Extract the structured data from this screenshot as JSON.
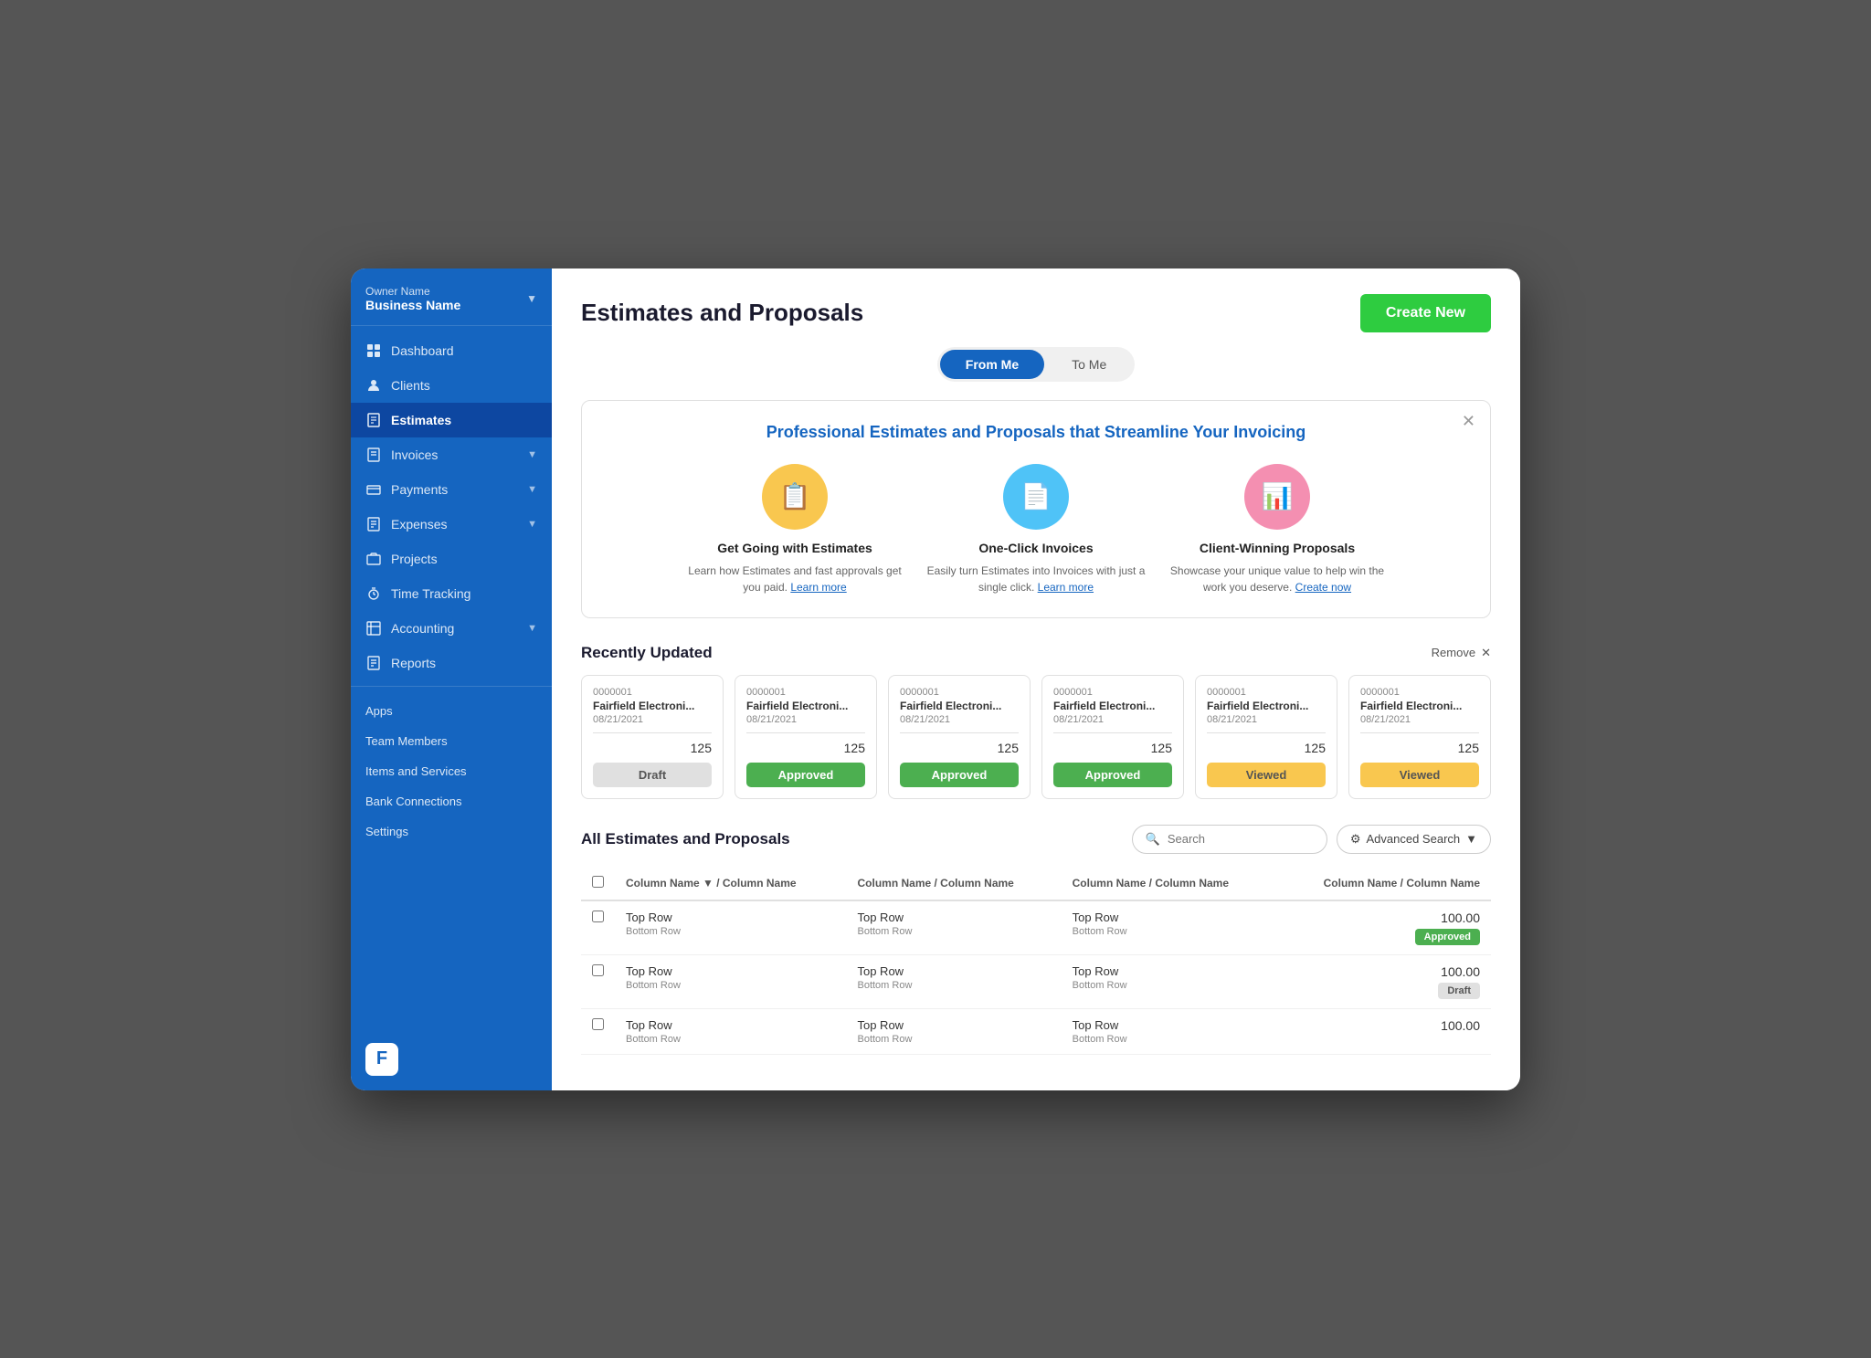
{
  "sidebar": {
    "owner": "Owner Name",
    "business": "Business Name",
    "nav": [
      {
        "id": "dashboard",
        "label": "Dashboard",
        "icon": "📊",
        "active": false,
        "hasChevron": false
      },
      {
        "id": "clients",
        "label": "Clients",
        "icon": "👤",
        "active": false,
        "hasChevron": false
      },
      {
        "id": "estimates",
        "label": "Estimates",
        "icon": "📋",
        "active": true,
        "hasChevron": false
      },
      {
        "id": "invoices",
        "label": "Invoices",
        "icon": "🧾",
        "active": false,
        "hasChevron": true
      },
      {
        "id": "payments",
        "label": "Payments",
        "icon": "💳",
        "active": false,
        "hasChevron": true
      },
      {
        "id": "expenses",
        "label": "Expenses",
        "icon": "📁",
        "active": false,
        "hasChevron": true
      },
      {
        "id": "projects",
        "label": "Projects",
        "icon": "🗂️",
        "active": false,
        "hasChevron": false
      },
      {
        "id": "time-tracking",
        "label": "Time Tracking",
        "icon": "⏱",
        "active": false,
        "hasChevron": false
      },
      {
        "id": "accounting",
        "label": "Accounting",
        "icon": "📈",
        "active": false,
        "hasChevron": true
      },
      {
        "id": "reports",
        "label": "Reports",
        "icon": "📊",
        "active": false,
        "hasChevron": false
      }
    ],
    "secondary": [
      {
        "id": "apps",
        "label": "Apps"
      },
      {
        "id": "team-members",
        "label": "Team Members"
      },
      {
        "id": "items-services",
        "label": "Items and Services"
      },
      {
        "id": "bank-connections",
        "label": "Bank Connections"
      },
      {
        "id": "settings",
        "label": "Settings"
      }
    ]
  },
  "page": {
    "title": "Estimates and Proposals",
    "create_button": "Create New"
  },
  "tabs": {
    "from_me": "From Me",
    "to_me": "To Me",
    "active": "from_me"
  },
  "promo": {
    "title": "Professional Estimates and Proposals that Streamline Your Invoicing",
    "cards": [
      {
        "id": "estimates",
        "color": "yellow",
        "icon": "📋",
        "title": "Get Going with Estimates",
        "desc": "Learn how Estimates and fast approvals get you paid.",
        "link_text": "Learn more"
      },
      {
        "id": "invoices",
        "color": "blue",
        "icon": "📄",
        "title": "One-Click Invoices",
        "desc": "Easily turn Estimates into Invoices with just a single click.",
        "link_text": "Learn more"
      },
      {
        "id": "proposals",
        "color": "pink",
        "icon": "📊",
        "title": "Client-Winning Proposals",
        "desc": "Showcase your unique value to help win the work you deserve.",
        "link_text": "Create now"
      }
    ]
  },
  "recently_updated": {
    "title": "Recently Updated",
    "remove_label": "Remove",
    "cards": [
      {
        "number": "0000001",
        "name": "Fairfield Electroni...",
        "date": "08/21/2021",
        "amount": "125",
        "status": "Draft",
        "status_class": "draft"
      },
      {
        "number": "0000001",
        "name": "Fairfield Electroni...",
        "date": "08/21/2021",
        "amount": "125",
        "status": "Approved",
        "status_class": "approved"
      },
      {
        "number": "0000001",
        "name": "Fairfield Electroni...",
        "date": "08/21/2021",
        "amount": "125",
        "status": "Approved",
        "status_class": "approved"
      },
      {
        "number": "0000001",
        "name": "Fairfield Electroni...",
        "date": "08/21/2021",
        "amount": "125",
        "status": "Approved",
        "status_class": "approved"
      },
      {
        "number": "0000001",
        "name": "Fairfield Electroni...",
        "date": "08/21/2021",
        "amount": "125",
        "status": "Viewed",
        "status_class": "viewed"
      },
      {
        "number": "0000001",
        "name": "Fairfield Electroni...",
        "date": "08/21/2021",
        "amount": "125",
        "status": "Viewed",
        "status_class": "viewed"
      }
    ]
  },
  "all_estimates": {
    "title": "All Estimates and Proposals",
    "search_placeholder": "Search",
    "advanced_search": "Advanced Search",
    "columns": [
      "Column Name ▼ / Column Name",
      "Column Name / Column Name",
      "Column Name / Column Name",
      "Column Name / Column Name"
    ],
    "rows": [
      {
        "top1": "Top Row",
        "bottom1": "Bottom Row",
        "top2": "Top Row",
        "bottom2": "Bottom Row",
        "top3": "Top Row",
        "bottom3": "Bottom Row",
        "amount": "100.00",
        "status": "Approved",
        "status_class": "approved"
      },
      {
        "top1": "Top Row",
        "bottom1": "Bottom Row",
        "top2": "Top Row",
        "bottom2": "Bottom Row",
        "top3": "Top Row",
        "bottom3": "Bottom Row",
        "amount": "100.00",
        "status": "Draft",
        "status_class": "draft"
      },
      {
        "top1": "Top Row",
        "bottom1": "Bottom Row",
        "top2": "Top Row",
        "bottom2": "Bottom Row",
        "top3": "Top Row",
        "bottom3": "Bottom Row",
        "amount": "100.00",
        "status": "",
        "status_class": ""
      }
    ]
  }
}
